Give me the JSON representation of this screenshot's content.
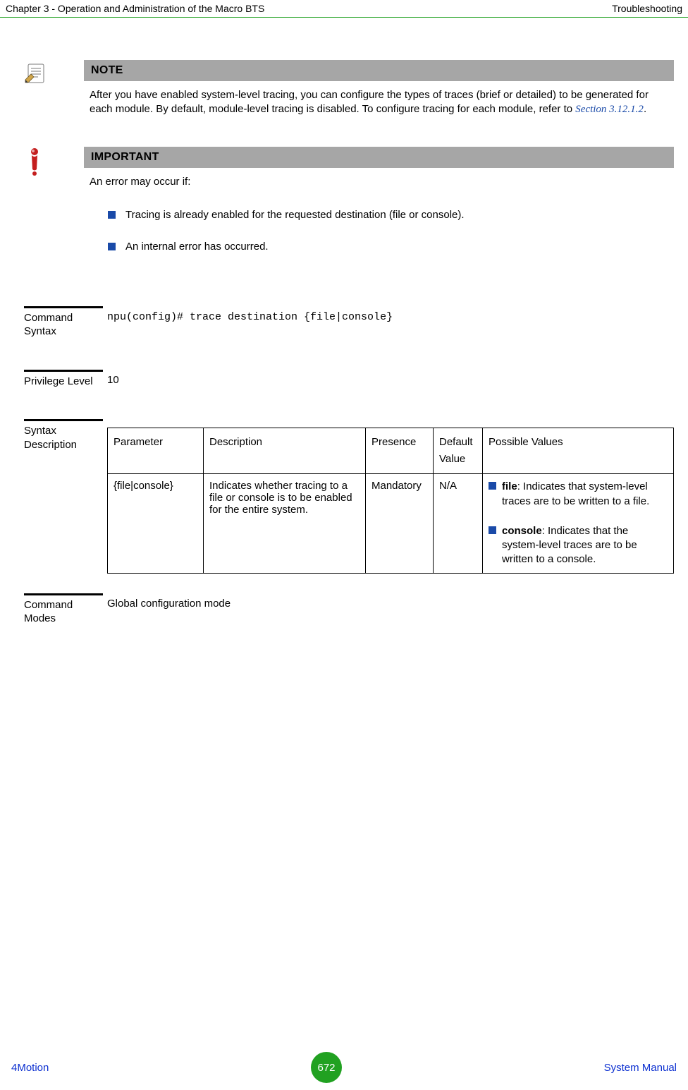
{
  "header": {
    "left": "Chapter 3 - Operation and Administration of the Macro BTS",
    "right": "Troubleshooting"
  },
  "note": {
    "title": "NOTE",
    "body_pre": "After you have enabled system-level tracing, you can configure the types of traces (brief or detailed) to be generated for each module. By default, module-level tracing is disabled. To configure tracing for each module, refer to ",
    "link": "Section 3.12.1.2",
    "body_post": "."
  },
  "important": {
    "title": "IMPORTANT",
    "lead": "An error may occur if:",
    "items": [
      "Tracing is already enabled for the requested destination (file or console).",
      "An internal error has occurred."
    ]
  },
  "rows": {
    "command_syntax": {
      "label": "Command Syntax",
      "value": "npu(config)# trace destination {file|console}"
    },
    "privilege_level": {
      "label": "Privilege Level",
      "value": "10"
    },
    "syntax_description": {
      "label": "Syntax Description"
    },
    "command_modes": {
      "label": "Command Modes",
      "value": "Global configuration mode"
    }
  },
  "table": {
    "headers": {
      "parameter": "Parameter",
      "description": "Description",
      "presence": "Presence",
      "default_value": "Default Value",
      "possible_values": "Possible Values"
    },
    "row": {
      "parameter": "{file|console}",
      "description": "Indicates whether tracing to a file or console is to be enabled for the entire system.",
      "presence": "Mandatory",
      "default_value": "N/A",
      "possible_values": [
        {
          "bold": "file",
          "rest": ": Indicates that system-level traces are to be written to a file."
        },
        {
          "bold": "console",
          "rest": ": Indicates that the system-level traces are to be written to a console."
        }
      ]
    }
  },
  "footer": {
    "left": "4Motion",
    "page": "672",
    "right": "System Manual"
  }
}
